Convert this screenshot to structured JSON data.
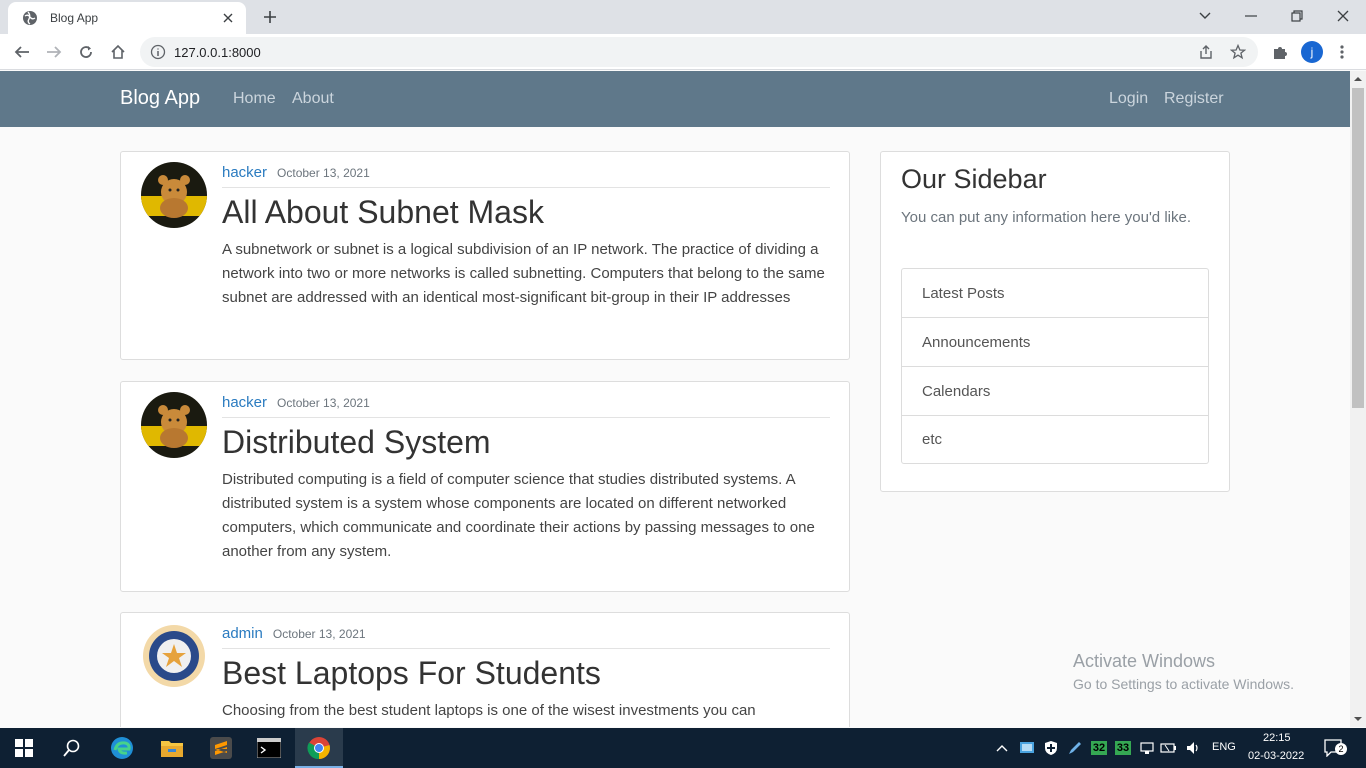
{
  "browser": {
    "tab_title": "Blog App",
    "url": "127.0.0.1:8000",
    "profile_initial": "j"
  },
  "navbar": {
    "brand": "Blog App",
    "links_left": [
      "Home",
      "About"
    ],
    "links_right": [
      "Login",
      "Register"
    ]
  },
  "posts": [
    {
      "author": "hacker",
      "date": "October 13, 2021",
      "title": "All About Subnet Mask",
      "content": "A subnetwork or subnet is a logical subdivision of an IP network. The practice of dividing a network into two or more networks is called subnetting. Computers that belong to the same subnet are addressed with an identical most-significant bit-group in their IP addresses",
      "avatar": "teddy-bear-avatar"
    },
    {
      "author": "hacker",
      "date": "October 13, 2021",
      "title": "Distributed System",
      "content": "Distributed computing is a field of computer science that studies distributed systems. A distributed system is a system whose components are located on different networked computers, which communicate and coordinate their actions by passing messages to one another from any system.",
      "avatar": "teddy-bear-avatar"
    },
    {
      "author": "admin",
      "date": "October 13, 2021",
      "title": "Best Laptops For Students",
      "content": "Choosing from the best student laptops is one of the wisest investments you can",
      "avatar": "emblem-avatar"
    }
  ],
  "sidebar": {
    "title": "Our Sidebar",
    "text": "You can put any information here you'd like.",
    "items": [
      "Latest Posts",
      "Announcements",
      "Calendars",
      "etc"
    ]
  },
  "watermark": {
    "line1": "Activate Windows",
    "line2": "Go to Settings to activate Windows."
  },
  "taskbar": {
    "tray_badge_1": "32",
    "tray_badge_2": "33",
    "language": "ENG",
    "time": "22:15",
    "date": "02-03-2022",
    "notification_count": "2"
  },
  "colors": {
    "navbar": "#5f788a",
    "link": "#2a7bc0",
    "taskbar": "#0e2033"
  }
}
